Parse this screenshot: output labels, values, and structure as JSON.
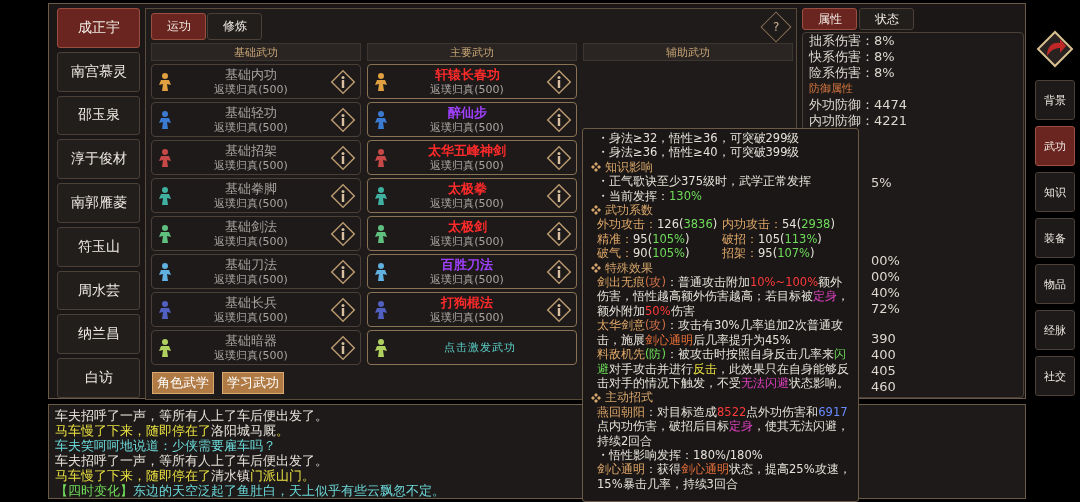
{
  "characters": [
    {
      "name": "成正宇",
      "selected": true
    },
    {
      "name": "南宫慕灵",
      "selected": false
    },
    {
      "name": "邵玉泉",
      "selected": false
    },
    {
      "name": "淳于俊材",
      "selected": false
    },
    {
      "name": "南郭雁菱",
      "selected": false
    },
    {
      "name": "符玉山",
      "selected": false
    },
    {
      "name": "周水芸",
      "selected": false
    },
    {
      "name": "纳兰昌",
      "selected": false
    },
    {
      "name": "白访",
      "selected": false
    }
  ],
  "tabs": [
    {
      "label": "运功",
      "selected": true
    },
    {
      "label": "修炼",
      "selected": false
    }
  ],
  "help_label": "?",
  "columns": [
    "基础武功",
    "主要武功",
    "辅助武功"
  ],
  "rows": [
    {
      "color": "#e0a040",
      "basic": {
        "name": "基础内功",
        "level": "返璞归真(500)"
      },
      "main": {
        "kind": "skill",
        "name": "轩辕长春功",
        "level": "返璞归真(500)",
        "color": "#ff2a2a"
      }
    },
    {
      "color": "#3a7ad0",
      "basic": {
        "name": "基础轻功",
        "level": "返璞归真(500)"
      },
      "main": {
        "kind": "skill",
        "name": "醉仙步",
        "level": "返璞归真(500)",
        "color": "#a040ff"
      }
    },
    {
      "color": "#c84848",
      "basic": {
        "name": "基础招架",
        "level": "返璞归真(500)"
      },
      "main": {
        "kind": "skill",
        "name": "太华五峰神剑",
        "level": "返璞归真(500)",
        "color": "#ff2a2a"
      }
    },
    {
      "color": "#40b0a0",
      "basic": {
        "name": "基础拳脚",
        "level": "返璞归真(500)"
      },
      "main": {
        "kind": "skill",
        "name": "太极拳",
        "level": "返璞归真(500)",
        "color": "#ff2a2a"
      }
    },
    {
      "color": "#60c080",
      "basic": {
        "name": "基础剑法",
        "level": "返璞归真(500)"
      },
      "main": {
        "kind": "skill",
        "name": "太极剑",
        "level": "返璞归真(500)",
        "color": "#ff2a2a"
      }
    },
    {
      "color": "#60b0e0",
      "basic": {
        "name": "基础刀法",
        "level": "返璞归真(500)"
      },
      "main": {
        "kind": "skill",
        "name": "百胜刀法",
        "level": "返璞归真(500)",
        "color": "#a040ff"
      }
    },
    {
      "color": "#5060c0",
      "basic": {
        "name": "基础长兵",
        "level": "返璞归真(500)"
      },
      "main": {
        "kind": "skill",
        "name": "打狗棍法",
        "level": "返璞归真(500)",
        "color": "#ff2a2a"
      }
    },
    {
      "color": "#b0d060",
      "basic": {
        "name": "基础暗器",
        "level": "返璞归真(500)"
      },
      "main": {
        "kind": "prompt",
        "name": "点击激发武功"
      }
    }
  ],
  "actions": [
    "角色武学",
    "学习武功"
  ],
  "stat_tabs": [
    {
      "label": "属性",
      "selected": true
    },
    {
      "label": "状态",
      "selected": false
    }
  ],
  "stats": [
    {
      "kind": "stat",
      "text": "拙系伤害：8%"
    },
    {
      "kind": "stat",
      "text": "快系伤害：8%"
    },
    {
      "kind": "stat",
      "text": "险系伤害：8%"
    },
    {
      "kind": "heading",
      "text": "防御属性"
    },
    {
      "kind": "stat",
      "text": "外功防御：4474"
    },
    {
      "kind": "stat",
      "text": "内功防御：4221"
    }
  ],
  "stat_fragments": [
    "5%",
    "00%",
    "00%",
    "40%",
    "72%",
    "390",
    "400",
    "405",
    "460"
  ],
  "nav": [
    {
      "label": "背景",
      "selected": false
    },
    {
      "label": "武功",
      "selected": true
    },
    {
      "label": "知识",
      "selected": false
    },
    {
      "label": "装备",
      "selected": false
    },
    {
      "label": "物品",
      "selected": false
    },
    {
      "label": "经脉",
      "selected": false
    },
    {
      "label": "社交",
      "selected": false
    }
  ],
  "log": [
    [
      {
        "kind": "plain",
        "text": "车夫招呼了一声，等所有人上了车后便出发了。"
      }
    ],
    [
      {
        "kind": "notice",
        "text": "马车慢了下来，随即停在了"
      },
      {
        "kind": "plain",
        "text": "洛阳城马厩"
      },
      {
        "kind": "notice",
        "text": "。"
      }
    ],
    [
      {
        "kind": "speech",
        "text": "车夫笑呵呵地说道：少侠需要雇车吗？"
      }
    ],
    [
      {
        "kind": "plain",
        "text": "车夫招呼了一声，等所有人上了车后便出发了。"
      }
    ],
    [
      {
        "kind": "notice",
        "text": "马车慢了下来，随即停在了"
      },
      {
        "kind": "plain",
        "text": "清水镇"
      },
      {
        "kind": "notice",
        "text": "门派山门。"
      }
    ],
    [
      {
        "kind": "good",
        "text": "【四时变化】"
      },
      {
        "kind": "speech",
        "text": "东边的天空泛起了鱼肚白，天上似乎有些云飘忽不定。"
      }
    ]
  ],
  "tooltip": {
    "sections": [
      {
        "lines": [
          [
            {
              "kind": "plain",
              "text": "・身法≥32，悟性≥36，可突破299级"
            }
          ],
          [
            {
              "kind": "plain",
              "text": "・身法≥36，悟性≥40，可突破399级"
            }
          ]
        ]
      },
      {
        "title": "知识影响",
        "lines": [
          [
            {
              "kind": "plain",
              "text": "・正气歌诀至少375级时，武学正常发挥"
            }
          ],
          [
            {
              "kind": "plain",
              "text": "・当前发挥："
            },
            {
              "kind": "good",
              "text": "130%"
            }
          ]
        ]
      },
      {
        "title": "武功系数",
        "grid": [
          [
            {
              "kind": "label",
              "text": "外功攻击："
            },
            {
              "kind": "plain",
              "text": "126("
            },
            {
              "kind": "good",
              "text": "3836"
            },
            {
              "kind": "plain",
              "text": ")"
            }
          ],
          [
            {
              "kind": "label",
              "text": "内功攻击："
            },
            {
              "kind": "plain",
              "text": "54("
            },
            {
              "kind": "good",
              "text": "2938"
            },
            {
              "kind": "plain",
              "text": ")"
            }
          ],
          [
            {
              "kind": "label",
              "text": "精准："
            },
            {
              "kind": "plain",
              "text": "95("
            },
            {
              "kind": "good",
              "text": "105%"
            },
            {
              "kind": "plain",
              "text": ")"
            }
          ],
          [
            {
              "kind": "label",
              "text": "破招："
            },
            {
              "kind": "plain",
              "text": "105("
            },
            {
              "kind": "good",
              "text": "113%"
            },
            {
              "kind": "plain",
              "text": ")"
            }
          ],
          [
            {
              "kind": "label",
              "text": "破气："
            },
            {
              "kind": "plain",
              "text": "90("
            },
            {
              "kind": "good",
              "text": "105%"
            },
            {
              "kind": "plain",
              "text": ")"
            }
          ],
          [
            {
              "kind": "label",
              "text": "招架："
            },
            {
              "kind": "plain",
              "text": "95("
            },
            {
              "kind": "good",
              "text": "107%"
            },
            {
              "kind": "plain",
              "text": ")"
            }
          ]
        ]
      },
      {
        "title": "特殊效果",
        "lines": [
          [
            {
              "kind": "label",
              "text": "剑出无痕"
            },
            {
              "kind": "attack",
              "text": "(攻)"
            },
            {
              "kind": "plain",
              "text": "：普通攻击附加"
            },
            {
              "kind": "bad",
              "text": "10%~100%"
            },
            {
              "kind": "plain",
              "text": "额外伤害，悟性越高额外伤害越高；若目标被"
            },
            {
              "kind": "status",
              "text": "定身"
            },
            {
              "kind": "plain",
              "text": "，额外附加"
            },
            {
              "kind": "bad",
              "text": "50%"
            },
            {
              "kind": "plain",
              "text": "伤害"
            }
          ],
          [
            {
              "kind": "label",
              "text": "太华剑意"
            },
            {
              "kind": "attack",
              "text": "(攻)"
            },
            {
              "kind": "plain",
              "text": "：攻击有30%几率追加2次普通攻击，施展"
            },
            {
              "kind": "skill",
              "text": "剑心通明"
            },
            {
              "kind": "plain",
              "text": "后几率提升为45%"
            }
          ],
          [
            {
              "kind": "label",
              "text": "料敌机先"
            },
            {
              "kind": "good",
              "text": "(防)"
            },
            {
              "kind": "plain",
              "text": "：被攻击时按照自身反击几率来"
            },
            {
              "kind": "good",
              "text": "闪避"
            },
            {
              "kind": "plain",
              "text": "对手攻击并进行"
            },
            {
              "kind": "counter",
              "text": "反击"
            },
            {
              "kind": "plain",
              "text": "，此效果只在自身能够反击对手的情况下触发，不受"
            },
            {
              "kind": "status",
              "text": "无法闪避"
            },
            {
              "kind": "plain",
              "text": "状态影响。"
            }
          ]
        ]
      },
      {
        "title": "主动招式",
        "lines": [
          [
            {
              "kind": "label",
              "text": "燕回朝阳"
            },
            {
              "kind": "plain",
              "text": "：对目标造成"
            },
            {
              "kind": "bad",
              "text": "8522"
            },
            {
              "kind": "plain",
              "text": "点外功伤害和"
            },
            {
              "kind": "inner",
              "text": "6917"
            },
            {
              "kind": "plain",
              "text": "点内功伤害，破招后目标"
            },
            {
              "kind": "status",
              "text": "定身"
            },
            {
              "kind": "plain",
              "text": "，使其无法闪避，持续2回合"
            }
          ],
          [
            {
              "kind": "plain",
              "text": "・悟性影响发挥：180%/180%"
            }
          ],
          [
            {
              "kind": "label",
              "text": "剑心通明"
            },
            {
              "kind": "plain",
              "text": "：获得"
            },
            {
              "kind": "skill",
              "text": "剑心通明"
            },
            {
              "kind": "plain",
              "text": "状态，提高25%攻速，15%暴击几率，持续3回合"
            }
          ]
        ]
      }
    ]
  }
}
